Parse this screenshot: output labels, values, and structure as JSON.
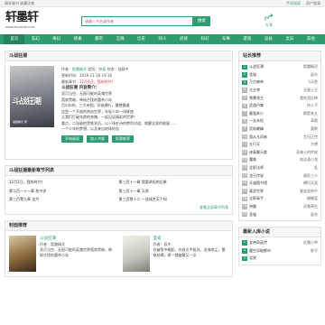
{
  "topbar": {
    "left": "阅轩阁书 收藏注册",
    "links": [
      "手机阅读",
      [
        "用户登录"
      ]
    ]
  },
  "logo": {
    "name": "轩墨轩",
    "url": "WWW.PRODUSE.COM"
  },
  "search": {
    "placeholder": "请输入书名或作者",
    "button": "搜索"
  },
  "share": {
    "label": "分享"
  },
  "nav": [
    "首页",
    "玄幻",
    "奇幻",
    "修真",
    "都市",
    "言情",
    "历史",
    "同人",
    "武侠",
    "科幻",
    "军事",
    "游戏",
    "竞技",
    "灵异",
    "其他"
  ],
  "book": {
    "section_title": "斗战狂潮",
    "cover_title": "斗战狂潮",
    "cover_sub": "骷髅精灵 著",
    "author_label": "作者：",
    "author": "骷髅精灵",
    "category_label": "类别：",
    "category": "修真",
    "status_label": "状态：",
    "status": "连载中",
    "update_label": "更新时间：",
    "update_time": "2016-11-26 19:16",
    "latest_label": "最新章节：",
    "latest": "12月1日，我的时代！",
    "intro_title": "斗战狂潮 内容简介：",
    "intro": "双月当空，无限可能的英魂世界\n孤寂黑暗，神秘古怪的嚣杀小岛\n百into的，三大帝国，异族横行，魔兽霸道\n这是一个开放的热血世界，年轻人的一场辉煌\n让我们打破年龄的束缚，一起见证精彩的世界！\n重点，二年级的黑铁学员，以一场史诗的惨烈对战，唤醒全部的能量……\n一个少年的梦想，以及来自地球的血",
    "buttons": [
      "开始阅读",
      "加入书架",
      "投票推荐"
    ]
  },
  "chapters": {
    "title": "斗战狂潮最新章节列表",
    "items": [
      "12月1日，我的时代！",
      "第三百十一章 我要承担的后果",
      "第二百一十一章 急中求",
      "第三百十一章 天养",
      "第三百零九章 金丹",
      "第三百零十二 一战成名天下知"
    ],
    "more": "查看全部章节列表"
  },
  "recommend": {
    "title": "封面推荐",
    "items": [
      {
        "name": "斗战狂潮",
        "author": "作者：骷髅精灵",
        "desc": "双月当空，无限可能的英魂世界孤寂黑暗，神秘古怪的嚣杀小岛"
      },
      {
        "name": "圣墟",
        "author": "作者：辰东",
        "desc": "在破败中崛起，在寂灭中复苏。沧海成尘，雷电枯竭，那一缕幽雾又一次"
      }
    ]
  },
  "sidebar": {
    "rank_title": "站长推荐",
    "rank": [
      {
        "name": "斗战狂潮",
        "author": "骷髅精灵"
      },
      {
        "name": "圣墟",
        "author": "辰东"
      },
      {
        "name": "万古神帝",
        "author": "飞天鱼"
      },
      {
        "name": "大主宰",
        "author": "天蚕土豆"
      },
      {
        "name": "雪鹰领主",
        "author": "我吃西红柿"
      },
      {
        "name": "武道丹尊",
        "author": "徐公子"
      },
      {
        "name": "最强弃少",
        "author": "鹅是老五"
      },
      {
        "name": "一念永恒",
        "author": "耳根"
      },
      {
        "name": "武炼巅峰",
        "author": "莫默"
      },
      {
        "name": "我从凡间来",
        "author": "言归正传"
      },
      {
        "name": "五行天",
        "author": "方想"
      },
      {
        "name": "修真聊天群",
        "author": "圣骑士的传说"
      },
      {
        "name": "魔临",
        "author": "纯洁滴小龙"
      },
      {
        "name": "全职法师",
        "author": "乱"
      },
      {
        "name": "龙王传说",
        "author": "唐家三少"
      },
      {
        "name": "天道图书馆",
        "author": "横扫天涯"
      },
      {
        "name": "真武世界",
        "author": "蚕茧里的牛"
      },
      {
        "name": "全职高手",
        "author": "蝴蝶蓝"
      },
      {
        "name": "帝霸",
        "author": "厌笔萧生"
      },
      {
        "name": "圣墟",
        "author": "辰东"
      }
    ],
    "new_title": "最新入库小说",
    "new": [
      {
        "name": "女帝奇英传",
        "author": "优雅小爷"
      },
      {
        "name": "重生异能都市",
        "author": "胖子"
      },
      {
        "name": "北冥",
        "author": ""
      }
    ]
  }
}
